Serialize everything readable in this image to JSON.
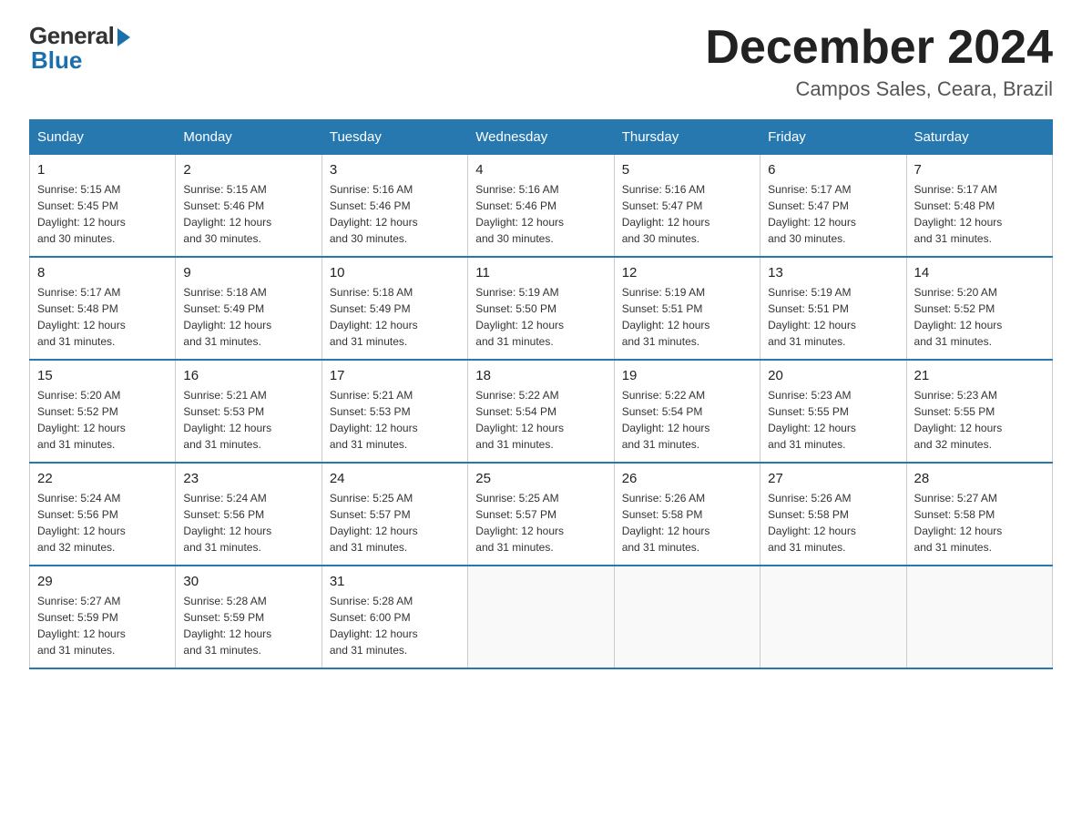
{
  "header": {
    "logo_general": "General",
    "logo_blue": "Blue",
    "month_title": "December 2024",
    "location": "Campos Sales, Ceara, Brazil"
  },
  "weekdays": [
    "Sunday",
    "Monday",
    "Tuesday",
    "Wednesday",
    "Thursday",
    "Friday",
    "Saturday"
  ],
  "weeks": [
    [
      {
        "day": "1",
        "sunrise": "5:15 AM",
        "sunset": "5:45 PM",
        "daylight": "12 hours and 30 minutes."
      },
      {
        "day": "2",
        "sunrise": "5:15 AM",
        "sunset": "5:46 PM",
        "daylight": "12 hours and 30 minutes."
      },
      {
        "day": "3",
        "sunrise": "5:16 AM",
        "sunset": "5:46 PM",
        "daylight": "12 hours and 30 minutes."
      },
      {
        "day": "4",
        "sunrise": "5:16 AM",
        "sunset": "5:46 PM",
        "daylight": "12 hours and 30 minutes."
      },
      {
        "day": "5",
        "sunrise": "5:16 AM",
        "sunset": "5:47 PM",
        "daylight": "12 hours and 30 minutes."
      },
      {
        "day": "6",
        "sunrise": "5:17 AM",
        "sunset": "5:47 PM",
        "daylight": "12 hours and 30 minutes."
      },
      {
        "day": "7",
        "sunrise": "5:17 AM",
        "sunset": "5:48 PM",
        "daylight": "12 hours and 31 minutes."
      }
    ],
    [
      {
        "day": "8",
        "sunrise": "5:17 AM",
        "sunset": "5:48 PM",
        "daylight": "12 hours and 31 minutes."
      },
      {
        "day": "9",
        "sunrise": "5:18 AM",
        "sunset": "5:49 PM",
        "daylight": "12 hours and 31 minutes."
      },
      {
        "day": "10",
        "sunrise": "5:18 AM",
        "sunset": "5:49 PM",
        "daylight": "12 hours and 31 minutes."
      },
      {
        "day": "11",
        "sunrise": "5:19 AM",
        "sunset": "5:50 PM",
        "daylight": "12 hours and 31 minutes."
      },
      {
        "day": "12",
        "sunrise": "5:19 AM",
        "sunset": "5:51 PM",
        "daylight": "12 hours and 31 minutes."
      },
      {
        "day": "13",
        "sunrise": "5:19 AM",
        "sunset": "5:51 PM",
        "daylight": "12 hours and 31 minutes."
      },
      {
        "day": "14",
        "sunrise": "5:20 AM",
        "sunset": "5:52 PM",
        "daylight": "12 hours and 31 minutes."
      }
    ],
    [
      {
        "day": "15",
        "sunrise": "5:20 AM",
        "sunset": "5:52 PM",
        "daylight": "12 hours and 31 minutes."
      },
      {
        "day": "16",
        "sunrise": "5:21 AM",
        "sunset": "5:53 PM",
        "daylight": "12 hours and 31 minutes."
      },
      {
        "day": "17",
        "sunrise": "5:21 AM",
        "sunset": "5:53 PM",
        "daylight": "12 hours and 31 minutes."
      },
      {
        "day": "18",
        "sunrise": "5:22 AM",
        "sunset": "5:54 PM",
        "daylight": "12 hours and 31 minutes."
      },
      {
        "day": "19",
        "sunrise": "5:22 AM",
        "sunset": "5:54 PM",
        "daylight": "12 hours and 31 minutes."
      },
      {
        "day": "20",
        "sunrise": "5:23 AM",
        "sunset": "5:55 PM",
        "daylight": "12 hours and 31 minutes."
      },
      {
        "day": "21",
        "sunrise": "5:23 AM",
        "sunset": "5:55 PM",
        "daylight": "12 hours and 32 minutes."
      }
    ],
    [
      {
        "day": "22",
        "sunrise": "5:24 AM",
        "sunset": "5:56 PM",
        "daylight": "12 hours and 32 minutes."
      },
      {
        "day": "23",
        "sunrise": "5:24 AM",
        "sunset": "5:56 PM",
        "daylight": "12 hours and 31 minutes."
      },
      {
        "day": "24",
        "sunrise": "5:25 AM",
        "sunset": "5:57 PM",
        "daylight": "12 hours and 31 minutes."
      },
      {
        "day": "25",
        "sunrise": "5:25 AM",
        "sunset": "5:57 PM",
        "daylight": "12 hours and 31 minutes."
      },
      {
        "day": "26",
        "sunrise": "5:26 AM",
        "sunset": "5:58 PM",
        "daylight": "12 hours and 31 minutes."
      },
      {
        "day": "27",
        "sunrise": "5:26 AM",
        "sunset": "5:58 PM",
        "daylight": "12 hours and 31 minutes."
      },
      {
        "day": "28",
        "sunrise": "5:27 AM",
        "sunset": "5:58 PM",
        "daylight": "12 hours and 31 minutes."
      }
    ],
    [
      {
        "day": "29",
        "sunrise": "5:27 AM",
        "sunset": "5:59 PM",
        "daylight": "12 hours and 31 minutes."
      },
      {
        "day": "30",
        "sunrise": "5:28 AM",
        "sunset": "5:59 PM",
        "daylight": "12 hours and 31 minutes."
      },
      {
        "day": "31",
        "sunrise": "5:28 AM",
        "sunset": "6:00 PM",
        "daylight": "12 hours and 31 minutes."
      },
      null,
      null,
      null,
      null
    ]
  ],
  "labels": {
    "sunrise": "Sunrise:",
    "sunset": "Sunset:",
    "daylight": "Daylight:"
  }
}
